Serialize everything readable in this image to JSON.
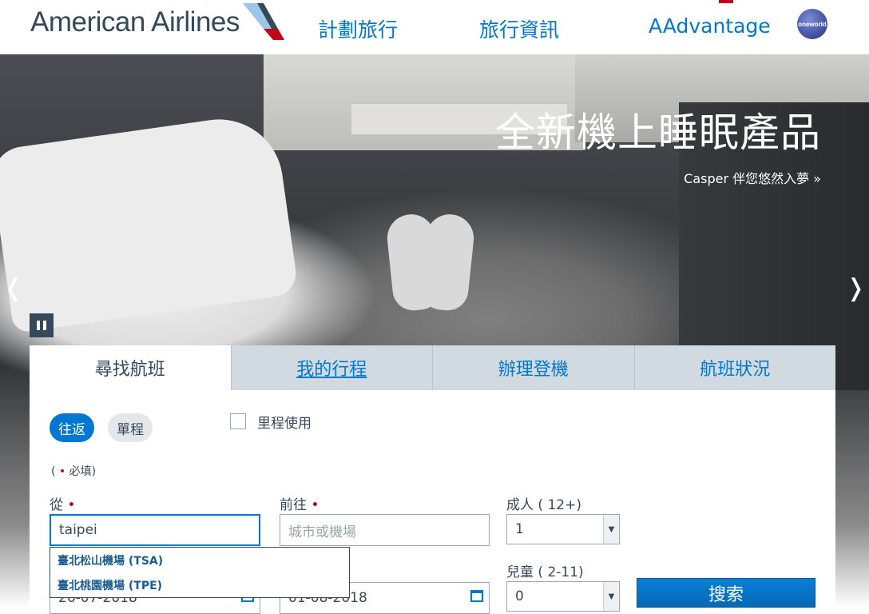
{
  "header": {
    "logo_text": "American Airlines",
    "nav": [
      "計劃旅行",
      "旅行資訊",
      "AAdvantage"
    ],
    "alliance_badge": "oneworld"
  },
  "hero": {
    "title": "全新機上睡眠產品",
    "subtitle": "Casper 伴您悠然入夢 »",
    "prev_arrow": "❬",
    "next_arrow": "❭"
  },
  "booking": {
    "tabs": [
      "尋找航班",
      "我的行程",
      "辦理登機",
      "航班狀況"
    ],
    "trip_types": [
      "往返",
      "單程"
    ],
    "miles_label": "里程使用",
    "required_note_prefix": "(",
    "required_note_dot": "•",
    "required_note_suffix": "必填)",
    "from": {
      "label": "從",
      "value": "taipei"
    },
    "to": {
      "label": "前往",
      "placeholder": "城市或機場"
    },
    "adults": {
      "label": "成人 ( 12+)",
      "value": "1"
    },
    "children": {
      "label": "兒童 ( 2-11)",
      "value": "0"
    },
    "depart_date": "26-07-2018",
    "return_date": "01-08-2018",
    "search_label": "搜索",
    "suggestions": [
      "臺北松山機場 (TSA)",
      "臺北桃園機場 (TPE)"
    ]
  },
  "colors": {
    "brand_blue": "#0078d2",
    "text_dark": "#36495a",
    "required_red": "#c30019"
  }
}
